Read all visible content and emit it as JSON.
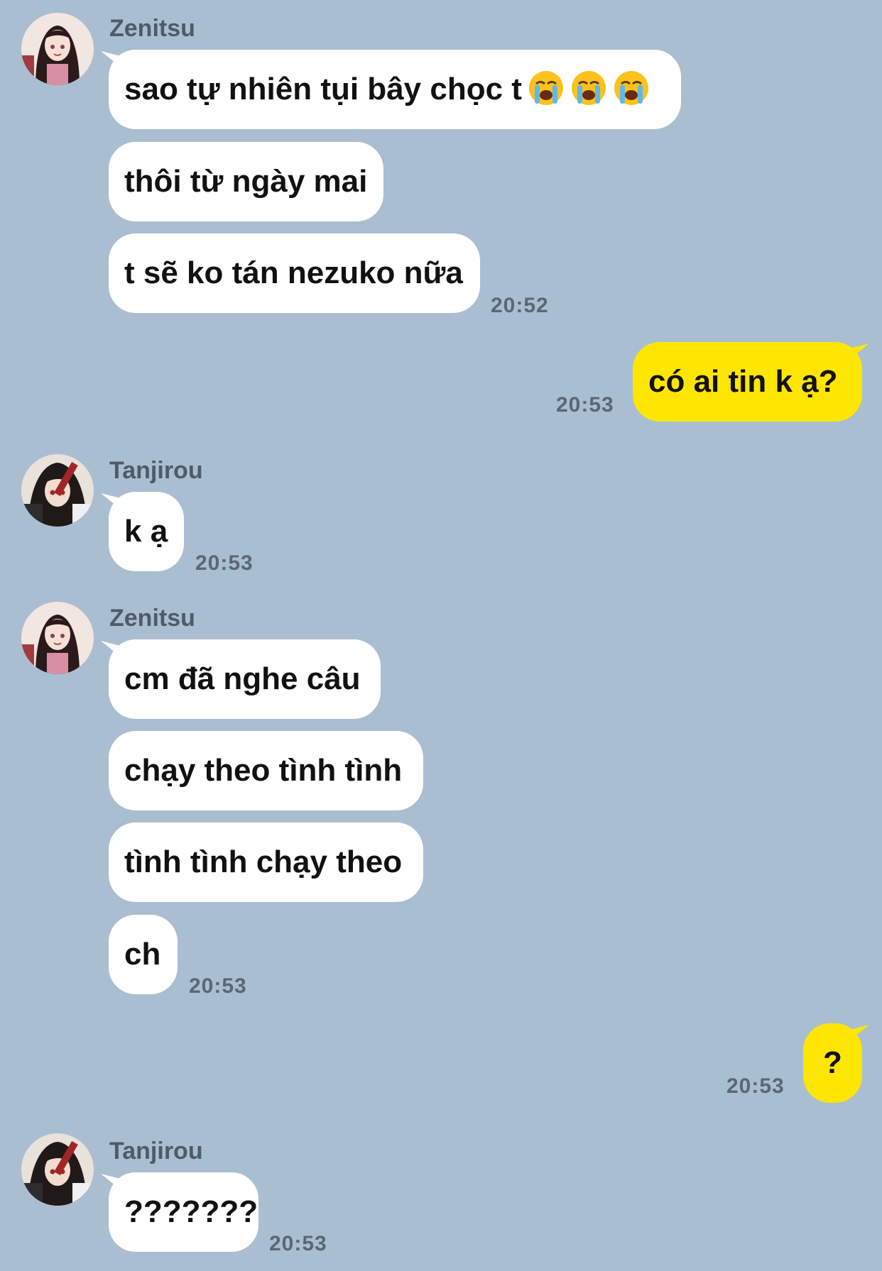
{
  "messages": {
    "z1": {
      "sender": "Zenitsu",
      "m1": "sao tự nhiên tụi bây chọc t",
      "m1_emoji": "loudly-crying-face-icon",
      "m2": "thôi từ ngày mai",
      "m3": "t sẽ ko tán nezuko nữa",
      "time": "20:52"
    },
    "me1": {
      "text": "có ai tin k ạ?",
      "time": "20:53"
    },
    "t1": {
      "sender": "Tanjirou",
      "m1": "k ạ",
      "time": "20:53"
    },
    "z2": {
      "sender": "Zenitsu",
      "m1": "cm đã nghe câu",
      "m2": "chạy theo tình tình",
      "m3": "tình tình chạy theo",
      "m4": "ch",
      "time": "20:53"
    },
    "me2": {
      "text": "?",
      "time": "20:53"
    },
    "t2": {
      "sender": "Tanjirou",
      "m1": "???????",
      "time": "20:53"
    }
  },
  "colors": {
    "background": "#aabed2",
    "incoming_bubble": "#ffffff",
    "outgoing_bubble": "#ffe600",
    "meta_text": "#5b6775"
  }
}
